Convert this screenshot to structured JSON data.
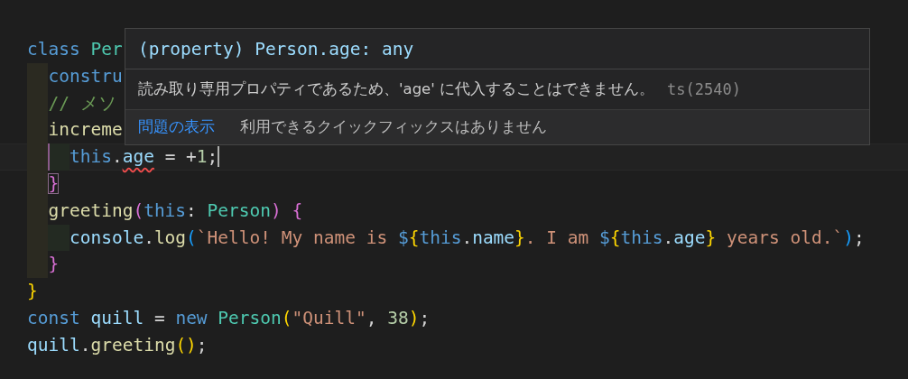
{
  "editor": {
    "lines": [
      {
        "current": false,
        "tokens": [
          {
            "text": "class ",
            "kind": "keyword"
          },
          {
            "text": "Per",
            "kind": "type"
          }
        ],
        "children": [
          {
            "current": false,
            "tokens": [
              {
                "text": "constru",
                "kind": "keyword"
              }
            ]
          },
          {
            "current": false,
            "tokens": [
              {
                "text": "// メソ",
                "kind": "comment"
              }
            ]
          },
          {
            "current": false,
            "tokens": [
              {
                "text": "increme",
                "kind": "function"
              }
            ],
            "children": [
              {
                "current": true,
                "tokens": [
                  {
                    "text": "this",
                    "kind": "keyword"
                  },
                  {
                    "text": ".",
                    "kind": "plain"
                  },
                  {
                    "text": "age",
                    "kind": "error"
                  },
                  {
                    "text": " = +",
                    "kind": "plain"
                  },
                  {
                    "text": "1",
                    "kind": "number"
                  },
                  {
                    "text": ";",
                    "kind": "plain"
                  }
                ]
              }
            ]
          },
          {
            "current": false,
            "tokens": [
              {
                "text": "}",
                "kind": "match"
              }
            ]
          },
          {
            "current": false,
            "tokens": [
              {
                "text": "greeting",
                "kind": "function"
              },
              {
                "text": "(",
                "kind": "pink"
              },
              {
                "text": "this",
                "kind": "keyword"
              },
              {
                "text": ": ",
                "kind": "plain"
              },
              {
                "text": "Person",
                "kind": "type"
              },
              {
                "text": ") {",
                "kind": "pink"
              }
            ],
            "children": [
              {
                "current": false,
                "tokens": [
                  {
                    "text": "console",
                    "kind": "variable"
                  },
                  {
                    "text": ".",
                    "kind": "plain"
                  },
                  {
                    "text": "log",
                    "kind": "function"
                  },
                  {
                    "text": "(",
                    "kind": "blue"
                  },
                  {
                    "text": "`Hello! My name is ",
                    "kind": "string"
                  },
                  {
                    "text": "$",
                    "kind": "keyword"
                  },
                  {
                    "text": "{",
                    "kind": "gold"
                  },
                  {
                    "text": "this",
                    "kind": "keyword"
                  },
                  {
                    "text": ".",
                    "kind": "plain"
                  },
                  {
                    "text": "name",
                    "kind": "variable"
                  },
                  {
                    "text": "}",
                    "kind": "gold"
                  },
                  {
                    "text": ". I am ",
                    "kind": "string"
                  },
                  {
                    "text": "$",
                    "kind": "keyword"
                  },
                  {
                    "text": "{",
                    "kind": "gold"
                  },
                  {
                    "text": "this",
                    "kind": "keyword"
                  },
                  {
                    "text": ".",
                    "kind": "plain"
                  },
                  {
                    "text": "age",
                    "kind": "variable"
                  },
                  {
                    "text": "}",
                    "kind": "gold"
                  },
                  {
                    "text": " years old.`",
                    "kind": "string"
                  },
                  {
                    "text": ")",
                    "kind": "blue"
                  },
                  {
                    "text": ";",
                    "kind": "plain"
                  }
                ]
              }
            ]
          },
          {
            "current": false,
            "tokens": [
              {
                "text": "}",
                "kind": "pink"
              }
            ]
          }
        ]
      },
      {
        "current": false,
        "tokens": [
          {
            "text": "}",
            "kind": "gold"
          }
        ]
      },
      {
        "current": false,
        "tokens": [
          {
            "text": "const ",
            "kind": "keyword"
          },
          {
            "text": "quill",
            "kind": "variable"
          },
          {
            "text": " = ",
            "kind": "plain"
          },
          {
            "text": "new ",
            "kind": "keyword"
          },
          {
            "text": "Person",
            "kind": "type"
          },
          {
            "text": "(",
            "kind": "gold"
          },
          {
            "text": "\"Quill\"",
            "kind": "string"
          },
          {
            "text": ", ",
            "kind": "plain"
          },
          {
            "text": "38",
            "kind": "number"
          },
          {
            "text": ")",
            "kind": "gold"
          },
          {
            "text": ";",
            "kind": "plain"
          }
        ]
      },
      {
        "current": false,
        "tokens": [
          {
            "text": "quill",
            "kind": "variable"
          },
          {
            "text": ".",
            "kind": "plain"
          },
          {
            "text": "greeting",
            "kind": "function"
          },
          {
            "text": "()",
            "kind": "gold"
          },
          {
            "text": ";",
            "kind": "plain"
          }
        ]
      }
    ]
  },
  "hover": {
    "signature": "(property) Person.age: any",
    "message": "読み取り専用プロパティであるため、'age' に代入することはできません。",
    "code": "ts(2540)",
    "link": "問題の表示",
    "note": "利用できるクイックフィックスはありません"
  }
}
